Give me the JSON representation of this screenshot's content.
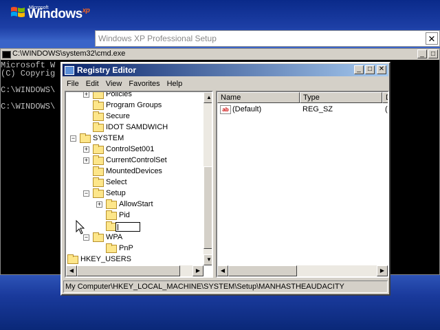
{
  "desktop": {
    "logo_microsoft": "Microsoft",
    "logo_windows": "Windows",
    "logo_xp": "xp"
  },
  "setup_window": {
    "title": "Windows XP Professional Setup",
    "close": "✕"
  },
  "cmd_window": {
    "title": "C:\\WINDOWS\\system32\\cmd.exe",
    "minimize": "_",
    "maximize": "□",
    "lines": [
      "Microsoft W",
      "(C) Copyrig",
      "",
      "C:\\WINDOWS\\",
      "",
      "C:\\WINDOWS\\"
    ]
  },
  "registry_editor": {
    "title": "Registry Editor",
    "minimize": "_",
    "maximize": "□",
    "close": "✕",
    "menu": [
      "File",
      "Edit",
      "View",
      "Favorites",
      "Help"
    ],
    "tree": [
      {
        "label": "Policies",
        "expander": "+"
      },
      {
        "label": "Program Groups",
        "expander": ""
      },
      {
        "label": "Secure",
        "expander": ""
      },
      {
        "label": "IDOT SAMDWICH",
        "expander": ""
      },
      {
        "label": "SYSTEM",
        "expander": "−"
      },
      {
        "label": "ControlSet001",
        "expander": "+"
      },
      {
        "label": "CurrentControlSet",
        "expander": "+"
      },
      {
        "label": "MountedDevices",
        "expander": ""
      },
      {
        "label": "Select",
        "expander": ""
      },
      {
        "label": "Setup",
        "expander": "−"
      },
      {
        "label": "AllowStart",
        "expander": "+"
      },
      {
        "label": "Pid",
        "expander": ""
      },
      {
        "label": "",
        "expander": ""
      },
      {
        "label": "WPA",
        "expander": "−"
      },
      {
        "label": "PnP",
        "expander": ""
      },
      {
        "label": "HKEY_USERS",
        "expander": ""
      }
    ],
    "columns": [
      "Name",
      "Type",
      "D"
    ],
    "values": [
      {
        "name": "(Default)",
        "type": "REG_SZ",
        "data": "("
      }
    ],
    "value_icon": "ab",
    "status": "My Computer\\HKEY_LOCAL_MACHINE\\SYSTEM\\Setup\\MANHASTHEAUDACITY"
  }
}
